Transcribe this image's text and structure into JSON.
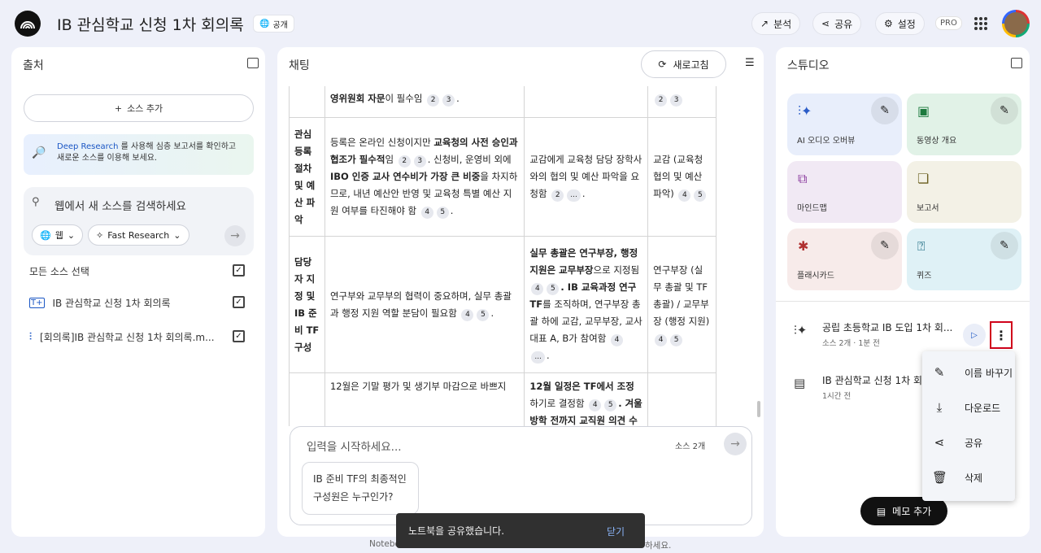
{
  "header": {
    "title": "IB 관심학교 신청 1차 회의록",
    "visibility": "공개",
    "analytics": "분석",
    "share": "공유",
    "settings": "설정",
    "pro": "PRO"
  },
  "sources": {
    "title": "출처",
    "add": "소스 추가",
    "deep_link": "Deep Research",
    "deep_text_1": " 를 사용해 심층 보고서를 확인하고",
    "deep_text_2": "새로운 소스를 이용해 보세요.",
    "search_placeholder": "웹에서 새 소스를 검색하세요",
    "web": "웹",
    "fast": "Fast Research",
    "select_all": "모든 소스 선택",
    "items": [
      "IB 관심학교 신청 1차 회의록",
      "[회의록]IB 관심학교 신청 1차 회의록.m..."
    ]
  },
  "chat": {
    "title": "채팅",
    "refresh": "새로고침",
    "input_placeholder": "입력을 시작하세요...",
    "source_count": "소스 2개",
    "suggestion_1": "IB 준비 TF의 최종적인",
    "suggestion_2": "구성원은 누구인가?",
    "footer": "Notebo",
    "footer_end": "하세요.",
    "r0c2a": "영위원회 자문",
    "r0c2b": "이 필수임",
    "r1c1": "관심 등록 절차 및 예산 파악",
    "r1c2_1": "등록은 온라인 신청이지만 ",
    "r1c2_b1": "교육청의 사전 승인과 협조가 필수적",
    "r1c2_2": "임",
    "r1c2_3": ". 신청비, 운영비 외에 ",
    "r1c2_b2": "IBO 인증 교사 연수비가 가장 큰 비중",
    "r1c2_4": "을 차지하므로, 내년 예산안 반영 및 교육청 특별 예산 지원 여부를 타진해야 함",
    "r1c3": "교감에게 교육청 담당 장학사와의 협의 및 예산 파악을 요청함",
    "r1c4": "교감 (교육청 협의 및 예산 파악)",
    "r2c1": "담당자 지정 및 IB 준비 TF 구성",
    "r2c2": "연구부와 교무부의 협력이 중요하며, 실무 총괄과 행정 지원 역할 분담이 필요함",
    "r2c3_b1": "실무 총괄은 연구부장, 행정 지원은 교무부장",
    "r2c3_1": "으로 지정됨",
    "r2c3_b2": ". IB 교육과정 연구 TF",
    "r2c3_2": "를 조직하며, 연구부장 총괄 하에 교감, 교무부장, 교사 대표 A, B가 참여함",
    "r2c4": "연구부장 (실무 총괄 및 TF 총괄) / 교무부장 (행정 지원)",
    "r3c2": "12월은 기말 평가 및 생기부 마감으로 바쁘지",
    "r3c3_b1": "12월 일정은 TF에서 조정",
    "r3c3_1": "하기로 결정함",
    "r3c3_b2": ". 겨울방학 전까지 교직원 의견 수",
    "c2": "2",
    "c3": "3",
    "c4": "4",
    "c5": "5",
    "cdots": "..."
  },
  "studio": {
    "title": "스튜디오",
    "tiles": [
      "AI 오디오 오버뷰",
      "동영상 개요",
      "마인드맵",
      "보고서",
      "플래시카드",
      "퀴즈"
    ],
    "note1_title": "공립 초등학교 IB 도입 1차 회...",
    "note1_meta": "소스 2개 · 1분 전",
    "note2_title": "IB 관심학교 신청 1차 회의",
    "note2_meta": "1시간 전",
    "add_memo": "메모 추가"
  },
  "menu": {
    "rename": "이름 바꾸기",
    "download": "다운로드",
    "share": "공유",
    "delete": "삭제"
  },
  "toast": {
    "text": "노트북을 공유했습니다.",
    "close": "닫기"
  },
  "colors": {
    "tile_blue": "#e8eefb",
    "tile_green": "#e1f2e7",
    "tile_purple": "#f1e9f4",
    "tile_beige": "#f3f1e6",
    "tile_pink": "#f7ebea",
    "tile_cyan": "#dff1f6",
    "highlight": "#d0021b"
  }
}
